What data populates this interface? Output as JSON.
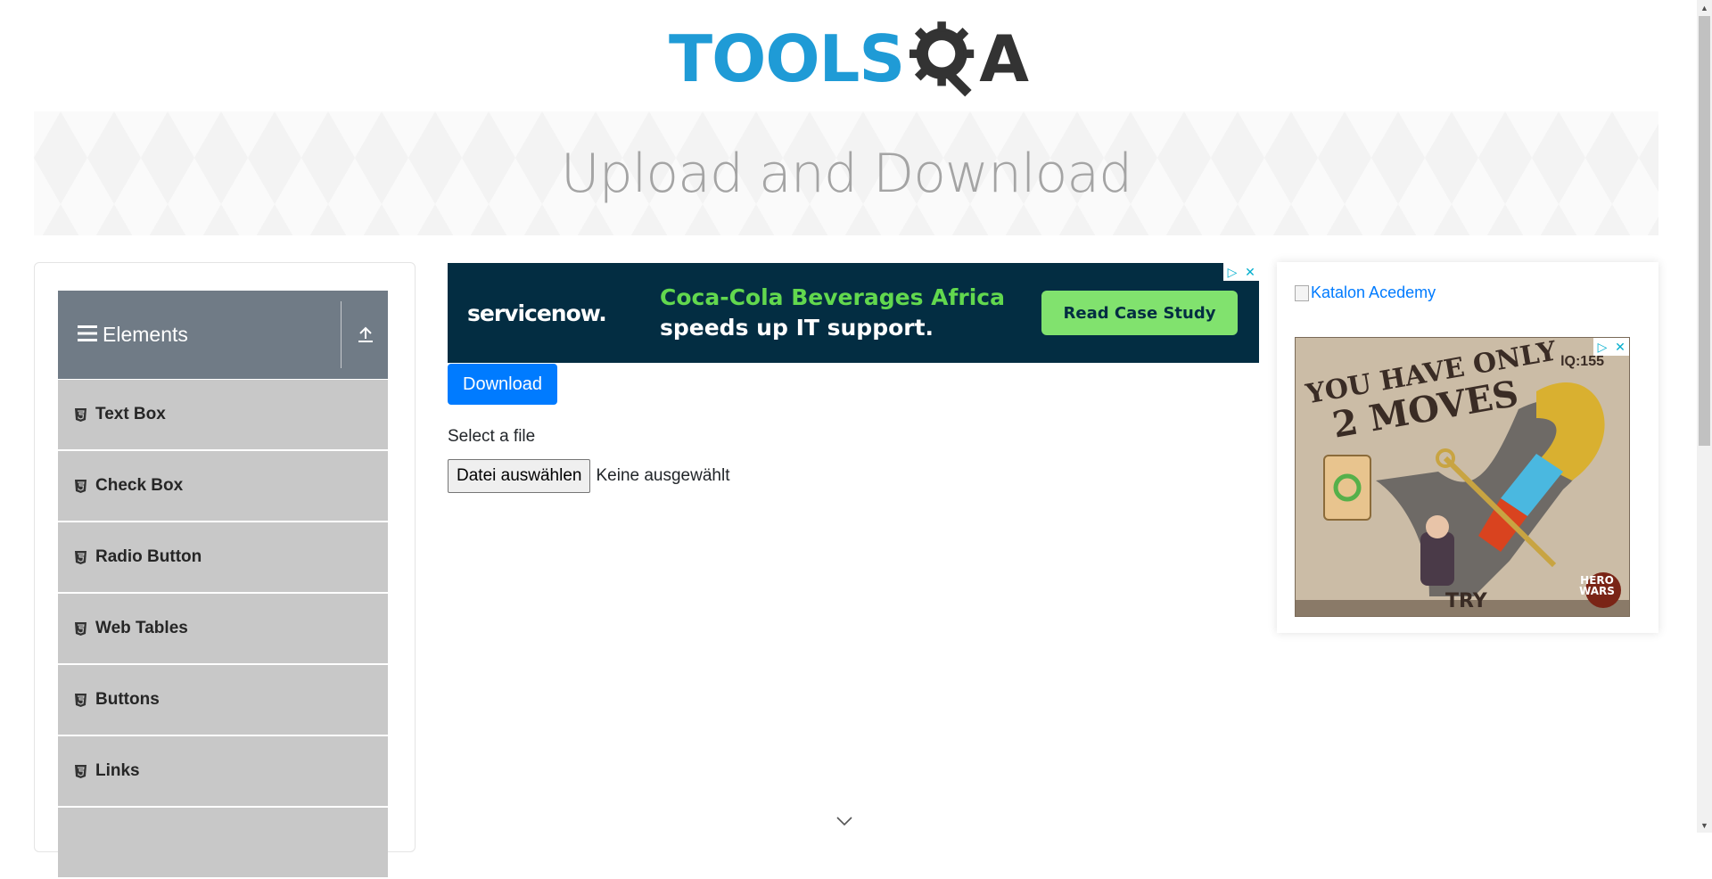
{
  "header": {
    "logo_text_left": "TOOLS",
    "logo_text_right": "A",
    "logo_colors": {
      "tools": "#1f9bd6",
      "qa": "#333333"
    }
  },
  "banner": {
    "title": "Upload and Download"
  },
  "sidebar": {
    "group_title": "Elements",
    "group_icon": "hamburger-icon",
    "toggle_icon": "collapse-up-icon",
    "items": [
      {
        "label": "Text Box",
        "icon": "html5-icon"
      },
      {
        "label": "Check Box",
        "icon": "html5-icon"
      },
      {
        "label": "Radio Button",
        "icon": "html5-icon"
      },
      {
        "label": "Web Tables",
        "icon": "html5-icon"
      },
      {
        "label": "Buttons",
        "icon": "html5-icon"
      },
      {
        "label": "Links",
        "icon": "html5-icon"
      }
    ]
  },
  "ad_top": {
    "brand": "servicenow.",
    "headline_line1": "Coca-Cola Beverages Africa",
    "headline_line2": "speeds up IT support.",
    "cta": "Read Case Study",
    "colors": {
      "background": "#032d42",
      "accent": "#62d84e",
      "cta": "#81e26e"
    }
  },
  "main": {
    "download_label": "Download",
    "select_label": "Select a file",
    "file_button": "Datei auswählen",
    "file_status": "Keine ausgewählt"
  },
  "right_column": {
    "katalon_link": "Katalon Acedemy",
    "game_ad": {
      "line1": "YOU HAVE ONLY",
      "line2": "2 MOVES",
      "level": "lQ:155",
      "cta": "TRY",
      "badge": "HERO WARS"
    }
  },
  "colors": {
    "primary_button": "#007bff",
    "sidebar_header": "#707b86",
    "sidebar_item": "#c8c8c8"
  }
}
